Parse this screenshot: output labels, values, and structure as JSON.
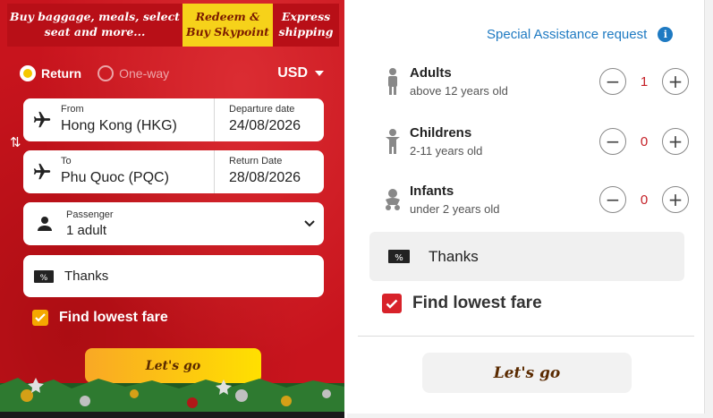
{
  "colors": {
    "brand_red": "#c8141d",
    "accent_yellow": "#f5c800",
    "link_blue": "#1e7ac2",
    "count_red": "#c41e25"
  },
  "top_bar": {
    "buy_baggage_line1": "Buy baggage, meals, select",
    "buy_baggage_line2": "seat and more...",
    "redeem_line1": "Redeem &",
    "redeem_line2": "Buy Skypoint",
    "express_line1": "Express",
    "express_line2": "shipping"
  },
  "trip_type": {
    "return_label": "Return",
    "oneway_label": "One-way",
    "selected": "Return"
  },
  "currency": {
    "value": "USD"
  },
  "outbound": {
    "from_label": "From",
    "from_value": "Hong Kong (HKG)",
    "date_label": "Departure date",
    "date_value": "24/08/2026"
  },
  "inbound": {
    "to_label": "To",
    "to_value": "Phu Quoc (PQC)",
    "date_label": "Return Date",
    "date_value": "28/08/2026"
  },
  "passenger": {
    "label": "Passenger",
    "value": "1 adult"
  },
  "promo": {
    "value": "Thanks"
  },
  "lowest_fare": {
    "label": "Find lowest fare",
    "checked": true
  },
  "go_button": {
    "label": "Let's go"
  },
  "assistance": {
    "label": "Special Assistance request",
    "icon": "info-icon"
  },
  "passengers": [
    {
      "name": "Adults",
      "desc": "above 12 years old",
      "count": "1",
      "icon": "adult-icon"
    },
    {
      "name": "Childrens",
      "desc": "2-11 years old",
      "count": "0",
      "icon": "child-icon"
    },
    {
      "name": "Infants",
      "desc": "under 2 years old",
      "count": "0",
      "icon": "infant-icon"
    }
  ],
  "stepper": {
    "minus": "−",
    "plus": "+"
  }
}
